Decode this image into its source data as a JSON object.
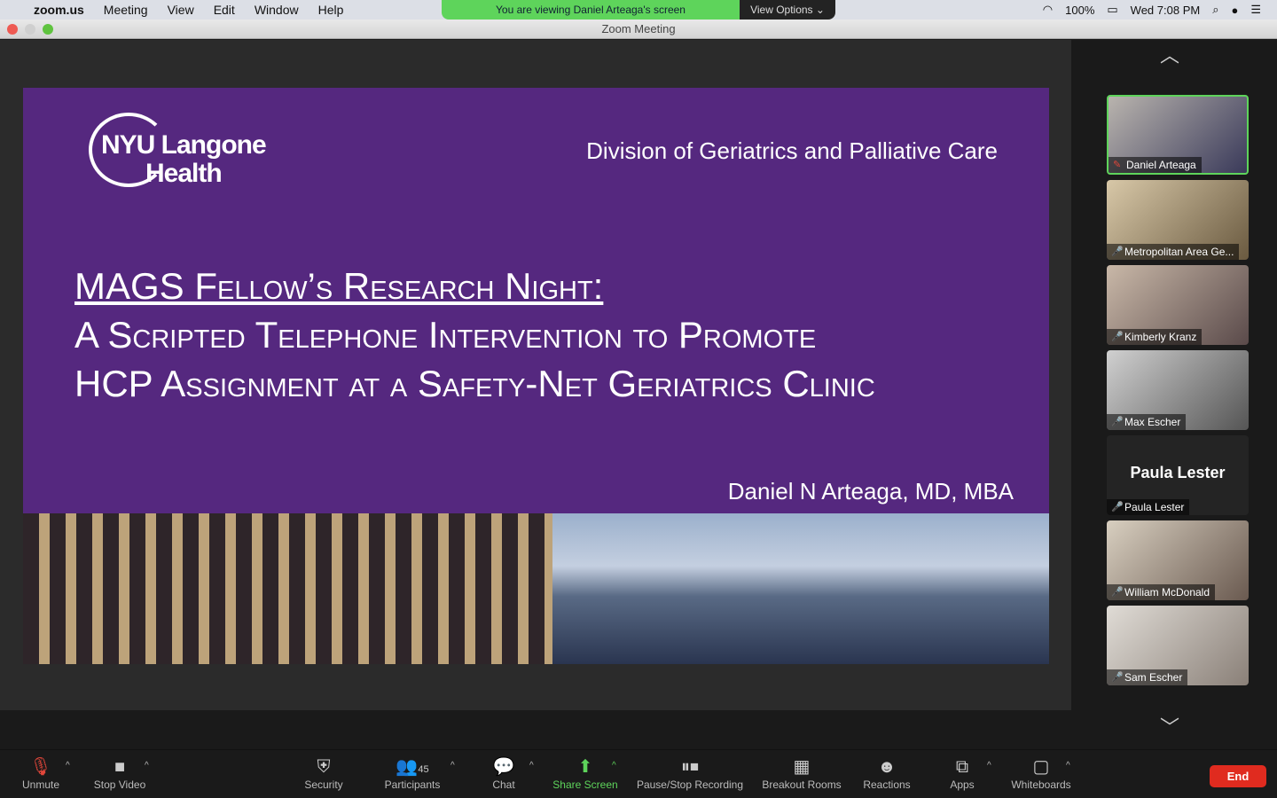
{
  "menubar": {
    "app": "zoom.us",
    "items": [
      "Meeting",
      "View",
      "Edit",
      "Window",
      "Help"
    ],
    "battery": "100%",
    "clock": "Wed 7:08 PM"
  },
  "banner": {
    "text": "You are viewing Daniel Arteaga's screen",
    "view_options": "View Options"
  },
  "window": {
    "title": "Zoom Meeting"
  },
  "slide": {
    "logo_line1": "NYU Langone",
    "logo_line2": "Health",
    "division": "Division of Geriatrics and Palliative Care",
    "title_line1": "MAGS Fellow’s Research Night:",
    "title_line2": "A Scripted Telephone Intervention to Promote",
    "title_line3": "HCP Assignment at a Safety-Net Geriatrics Clinic",
    "author": "Daniel N Arteaga, MD, MBA"
  },
  "participants": [
    {
      "name": "Daniel Arteaga",
      "active": true
    },
    {
      "name": "Metropolitan Area Ge..."
    },
    {
      "name": "Kimberly Kranz"
    },
    {
      "name": "Max Escher"
    },
    {
      "name": "Paula Lester",
      "big": "Paula Lester"
    },
    {
      "name": "William McDonald"
    },
    {
      "name": "Sam Escher"
    }
  ],
  "toolbar": {
    "unmute": "Unmute",
    "stop_video": "Stop Video",
    "security": "Security",
    "participants": "Participants",
    "participant_count": "45",
    "chat": "Chat",
    "share_screen": "Share Screen",
    "recording": "Pause/Stop Recording",
    "breakout": "Breakout Rooms",
    "reactions": "Reactions",
    "apps": "Apps",
    "whiteboards": "Whiteboards",
    "end": "End"
  }
}
